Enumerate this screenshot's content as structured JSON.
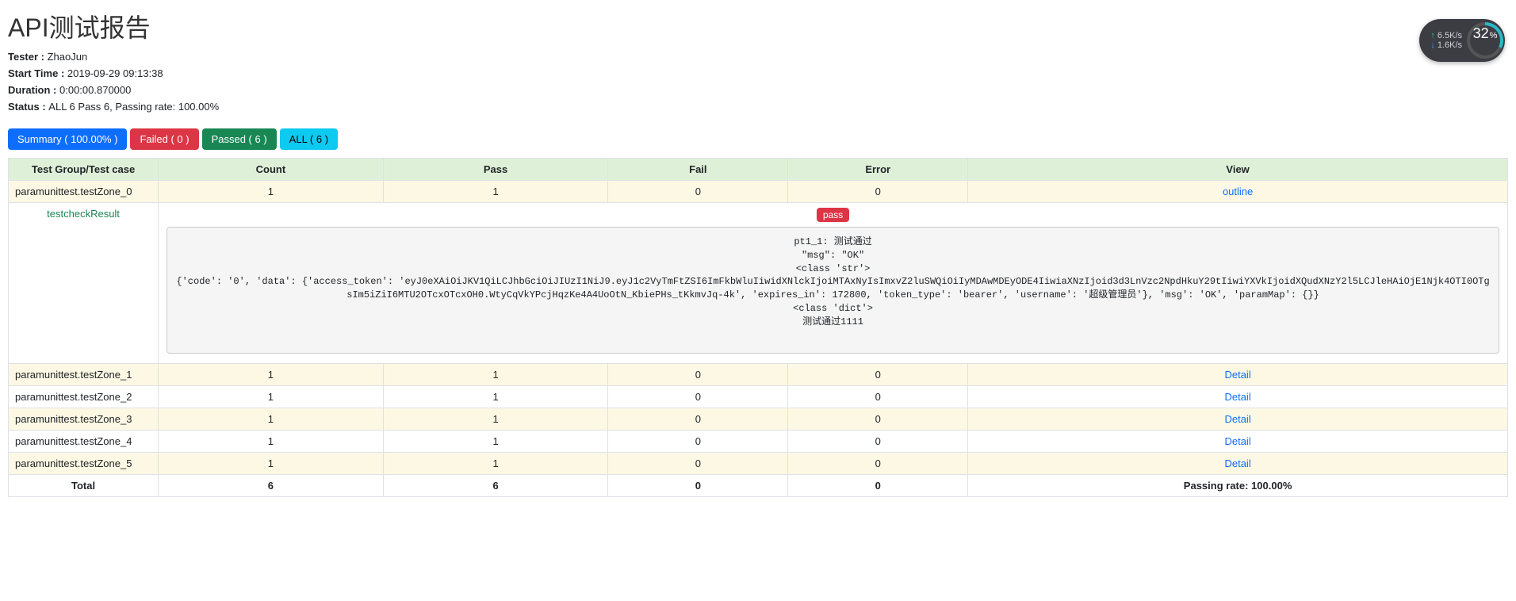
{
  "header": {
    "title": "API测试报告"
  },
  "meta": {
    "tester_label": "Tester : ",
    "tester_value": "ZhaoJun",
    "start_label": "Start Time : ",
    "start_value": "2019-09-29 09:13:38",
    "duration_label": "Duration : ",
    "duration_value": "0:00:00.870000",
    "status_label": "Status : ",
    "status_value": "ALL 6 Pass 6, Passing rate: 100.00%"
  },
  "tabs": {
    "summary": "Summary ( 100.00% )",
    "failed": "Failed ( 0 )",
    "passed": "Passed ( 6 )",
    "all": "ALL ( 6 )"
  },
  "columns": {
    "name": "Test Group/Test case",
    "count": "Count",
    "pass": "Pass",
    "fail": "Fail",
    "error": "Error",
    "view": "View"
  },
  "rows": [
    {
      "name": "paramunittest.testZone_0",
      "count": "1",
      "pass": "1",
      "fail": "0",
      "error": "0",
      "view": "outline",
      "cls": "odd"
    },
    {
      "name": "paramunittest.testZone_1",
      "count": "1",
      "pass": "1",
      "fail": "0",
      "error": "0",
      "view": "Detail",
      "cls": "odd"
    },
    {
      "name": "paramunittest.testZone_2",
      "count": "1",
      "pass": "1",
      "fail": "0",
      "error": "0",
      "view": "Detail",
      "cls": "even"
    },
    {
      "name": "paramunittest.testZone_3",
      "count": "1",
      "pass": "1",
      "fail": "0",
      "error": "0",
      "view": "Detail",
      "cls": "odd"
    },
    {
      "name": "paramunittest.testZone_4",
      "count": "1",
      "pass": "1",
      "fail": "0",
      "error": "0",
      "view": "Detail",
      "cls": "even"
    },
    {
      "name": "paramunittest.testZone_5",
      "count": "1",
      "pass": "1",
      "fail": "0",
      "error": "0",
      "view": "Detail",
      "cls": "odd"
    }
  ],
  "detail": {
    "case_name": "testcheckResult",
    "badge": "pass",
    "lines": [
      "pt1_1: 测试通过",
      "\"msg\": \"OK\"",
      "<class 'str'>",
      "{'code': '0', 'data': {'access_token': 'eyJ0eXAiOiJKV1QiLCJhbGciOiJIUzI1NiJ9.eyJ1c2VyTmFtZSI6ImFkbWluIiwidXNlckIjoiMTAxNyIsImxvZ2luSWQiOiIyMDAwMDEyODE4IiwiaXNzIjoid3d3LnVzc2NpdHkuY29tIiwiYXVkIjoidXQudXNzY2l5LCJleHAiOjE1Njk4OTI0OTgsIm5iZiI6MTU2OTcxOTcxOH0.WtyCqVkYPcjHqzKe4A4UoOtN_KbiePHs_tKkmvJq-4k', 'expires_in': 172800, 'token_type': 'bearer', 'username': '超级管理员'}, 'msg': 'OK', 'paramMap': {}}",
      "<class 'dict'>",
      "测试通过1111"
    ]
  },
  "total": {
    "label": "Total",
    "count": "6",
    "pass": "6",
    "fail": "0",
    "error": "0",
    "rate": "Passing rate: 100.00%"
  },
  "widget": {
    "up": "6.5K/s",
    "dn": "1.6K/s",
    "pct_num": "32",
    "pct_unit": "%"
  }
}
